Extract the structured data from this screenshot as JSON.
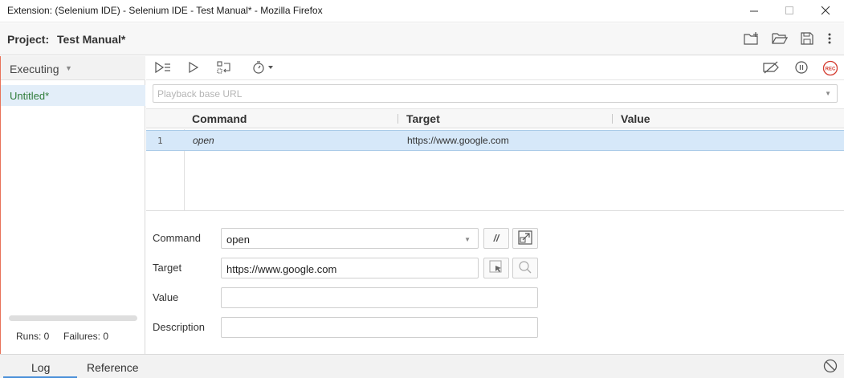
{
  "window": {
    "title": "Extension: (Selenium IDE) - Selenium IDE - Test Manual* - Mozilla Firefox",
    "minimize_icon": "minimize-icon",
    "maximize_icon": "maximize-icon",
    "close_icon": "close-icon"
  },
  "project": {
    "label": "Project:",
    "name": "Test Manual*",
    "actions": [
      "new-suite-icon",
      "open-project-icon",
      "save-project-icon",
      "more-options-icon"
    ]
  },
  "sidebar": {
    "mode": "Executing",
    "items": [
      {
        "label": "Untitled*",
        "status_color": "#2f7c3a"
      }
    ],
    "runs": "Runs: 0",
    "failures": "Failures: 0"
  },
  "toolbar": {
    "left": [
      "run-all-tests-icon",
      "run-current-test-icon",
      "step-over-icon",
      "speed-icon"
    ],
    "right": [
      "disable-breakpoints-icon",
      "pause-icon",
      "record-icon"
    ],
    "record_label": "REC"
  },
  "playback": {
    "placeholder": "Playback base URL",
    "value": ""
  },
  "grid": {
    "columns": [
      "Command",
      "Target",
      "Value"
    ],
    "rows": [
      {
        "num": "1",
        "command": "open",
        "target": "https://www.google.com",
        "value": ""
      }
    ]
  },
  "editor": {
    "command_label": "Command",
    "command_value": "open",
    "comment_btn": "//",
    "target_label": "Target",
    "target_value": "https://www.google.com",
    "value_label": "Value",
    "value_value": "",
    "description_label": "Description",
    "description_value": ""
  },
  "bottom": {
    "tabs": [
      "Log",
      "Reference"
    ],
    "active_tab": "Log"
  },
  "colors": {
    "selected_row": "#d6e8f9",
    "tab_underline": "#4a90d9",
    "record": "#d43b2f"
  }
}
